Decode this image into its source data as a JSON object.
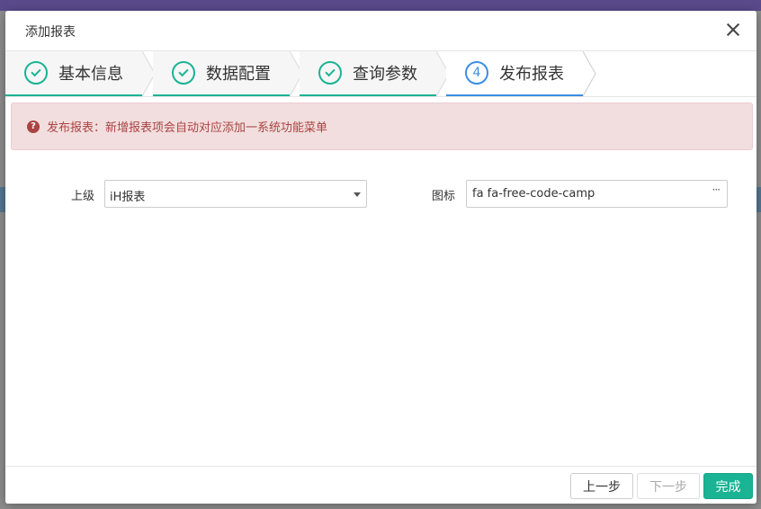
{
  "dialog": {
    "title": "添加报表"
  },
  "steps": [
    {
      "label": "基本信息",
      "state": "done"
    },
    {
      "label": "数据配置",
      "state": "done"
    },
    {
      "label": "查询参数",
      "state": "done"
    },
    {
      "label": "发布报表",
      "state": "active",
      "number": "4"
    }
  ],
  "alert": {
    "text": "发布报表：新增报表项会自动对应添加一系统功能菜单",
    "icon": "question-circle-icon"
  },
  "form": {
    "parent_label": "上级",
    "parent_value": "iH报表",
    "icon_label": "图标",
    "icon_value": "fa fa-free-code-camp",
    "icon_picker": "···"
  },
  "footer": {
    "prev": "上一步",
    "next": "下一步",
    "done": "完成"
  },
  "colors": {
    "accent": "#1ab394",
    "active_step": "#3a8ee6",
    "alert_bg": "#f2dede",
    "alert_text": "#a94442"
  }
}
